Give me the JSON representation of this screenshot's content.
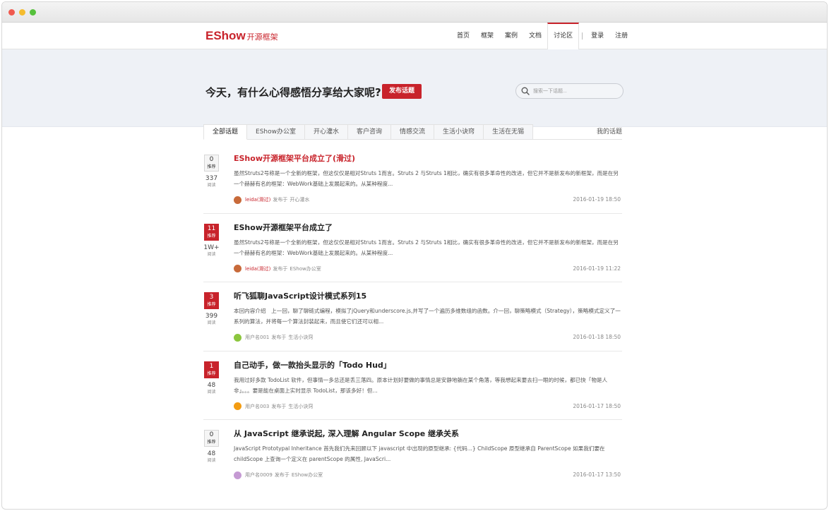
{
  "window": {
    "controls": [
      "close",
      "minimize",
      "maximize"
    ]
  },
  "brand": {
    "name": "EShow",
    "sub": "开源框架",
    "color": "#c8232b"
  },
  "nav": {
    "items": [
      "首页",
      "框架",
      "案例",
      "文档",
      "讨论区"
    ],
    "active": "讨论区",
    "login": "登录",
    "register": "注册"
  },
  "hero": {
    "title": "今天，有什么心得感悟分享给大家呢?",
    "publish_label": "发布话题",
    "search_placeholder": "搜索一下话题..."
  },
  "tabs": {
    "items": [
      "全部话题",
      "EShow办公室",
      "开心灌水",
      "客户咨询",
      "情感交流",
      "生活小诀窍",
      "生活在无锡"
    ],
    "active": "全部话题",
    "my_topics": "我的话题"
  },
  "labels": {
    "recommend": "推荐",
    "reads": "阅读",
    "posted_in": "发布于"
  },
  "topics": [
    {
      "recommend": "0",
      "hot": false,
      "reads": "337",
      "title": "EShow开源框架平台成立了(滑过)",
      "title_highlight": true,
      "excerpt": "虽然Struts2号称是一个全新的框架，但这仅仅是相对Struts 1而言。Struts 2 与Struts 1相比，确实有很多革命性的改进，但它并不是新发布的新框架，而是在另一个赫赫有名的框架：WebWork基础上发展起来的。从某种程度...",
      "author": "leida(滑过)",
      "author_red": true,
      "avatar_color": "#c86a3a",
      "board": "开心灌水",
      "date": "2016-01-19 18:50"
    },
    {
      "recommend": "11",
      "hot": true,
      "reads": "1W+",
      "title": "EShow开源框架平台成立了",
      "title_highlight": false,
      "excerpt": "虽然Struts2号称是一个全新的框架，但这仅仅是相对Struts 1而言。Struts 2 与Struts 1相比，确实有很多革命性的改进，但它并不是新发布的新框架，而是在另一个赫赫有名的框架：WebWork基础上发展起来的。从某种程度...",
      "author": "leida(滑过)",
      "author_red": true,
      "avatar_color": "#c86a3a",
      "board": "EShow办公室",
      "date": "2016-01-19 11:22"
    },
    {
      "recommend": "3",
      "hot": true,
      "reads": "399",
      "title": "听飞狐聊JavaScript设计模式系列15",
      "title_highlight": false,
      "excerpt": "本回内容介绍　上一回，聊了聊链式编程，模拟了jQuery和underscore.js,并写了一个遍历多维数组的函数。介一回，聊策略模式（Strategy），策略模式定义了一系列的算法，并将每一个算法封装起来，而且使它们还可以相...",
      "author": "用户名001",
      "author_red": false,
      "avatar_color": "#8cc63e",
      "board": "生活小诀窍",
      "date": "2016-01-18 18:50"
    },
    {
      "recommend": "1",
      "hot": true,
      "reads": "48",
      "title": "自己动手，做一款抬头显示的「Todo Hud」",
      "title_highlight": false,
      "excerpt": "我用过好多款 TodoList 软件，但事情一多总还是丢三落四。原本计划好要做的事情总是安静地躺在某个角落，等我想起来要去扫一眼的时候，都已快「物是人非」。。。要是能在桌面上实时显示 TodoList，那该多好！但...",
      "author": "用户名003",
      "author_red": false,
      "avatar_color": "#f39c12",
      "board": "生活小诀窍",
      "date": "2016-01-17 18:50"
    },
    {
      "recommend": "0",
      "hot": false,
      "reads": "48",
      "title": "从 JavaScript 继承说起, 深入理解 Angular Scope 继承关系",
      "title_highlight": false,
      "excerpt": "JavaScript Prototypal Inheritance 首先我们先来回顾以下 javascript 中出现的原型继承: {代码...} ChildScope 原型继承自 ParentScope 如果我们要在 childScope 上查询一个定义在 parentScope 的属性, JavaScri...",
      "author": "用户名0009",
      "author_red": false,
      "avatar_color": "#c59ad3",
      "board": "EShow办公室",
      "date": "2016-01-17 13:50"
    }
  ]
}
